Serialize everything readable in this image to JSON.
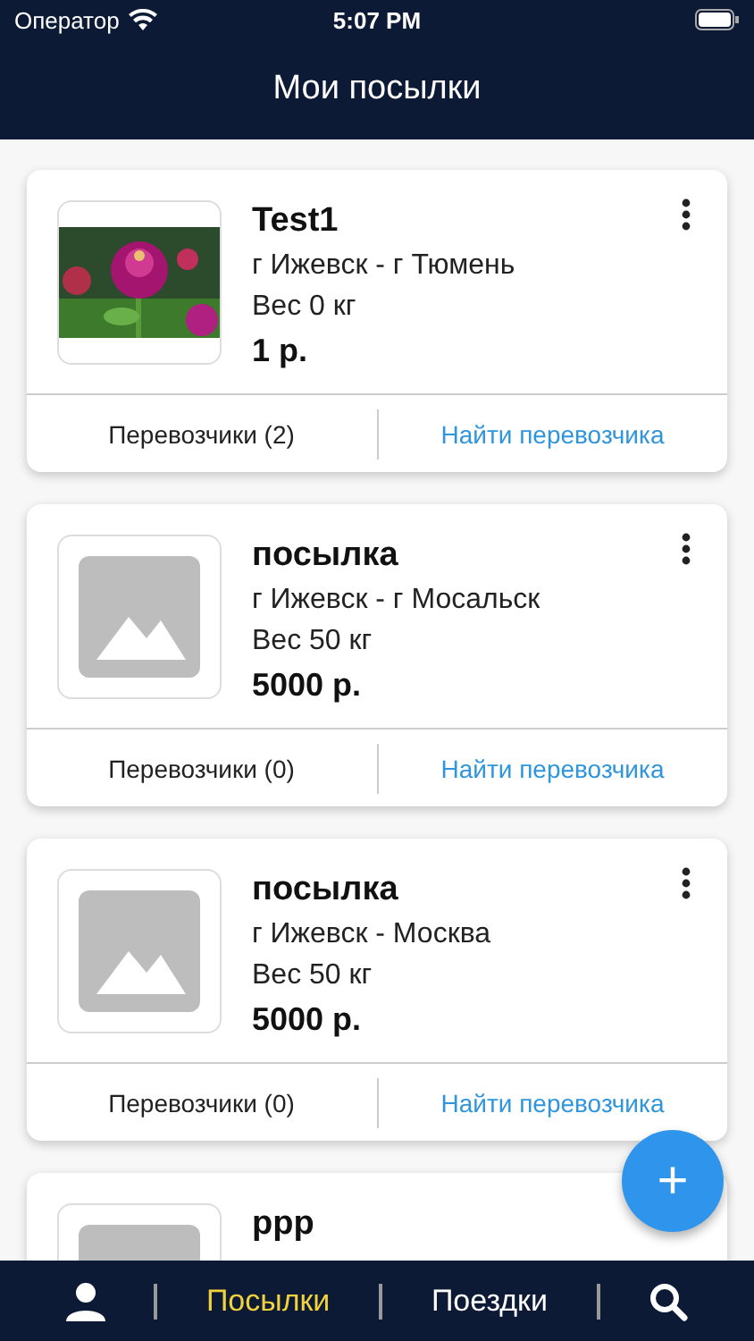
{
  "status_bar": {
    "carrier": "Оператор",
    "time": "5:07 PM"
  },
  "header": {
    "title": "Мои посылки"
  },
  "parcels": [
    {
      "menu": true,
      "title": "Test1",
      "route": "г Ижевск - г Тюмень",
      "weight": "Вес 0 кг",
      "price": "1 р.",
      "carriers": "Перевозчики (2)",
      "find": "Найти перевозчика"
    },
    {
      "kind": "placeholder",
      "menu": true,
      "title": "посылка",
      "route": "г Ижевск - г Мосальск",
      "weight": "Вес 50 кг",
      "price": "5000 р.",
      "carriers": "Перевозчики (0)",
      "find": "Найти перевозчика"
    },
    {
      "kind": "placeholder",
      "menu": true,
      "title": "посылка",
      "route": "г Ижевск - Москва",
      "weight": "Вес 50 кг",
      "price": "5000 р.",
      "carriers": "Перевозчики (0)",
      "find": "Найти перевозчика"
    },
    {
      "kind": "placeholder",
      "title": "ppp",
      "menu": false
    }
  ],
  "fab": {
    "label": "+"
  },
  "tab_bar": {
    "tabs": [
      {
        "kind": "icon",
        "selected": false
      },
      {
        "kind": "text",
        "label": "Посылки",
        "selected": true
      },
      {
        "kind": "text",
        "label": "Поездки",
        "selected": false
      },
      {
        "kind": "search",
        "selected": false
      }
    ]
  }
}
